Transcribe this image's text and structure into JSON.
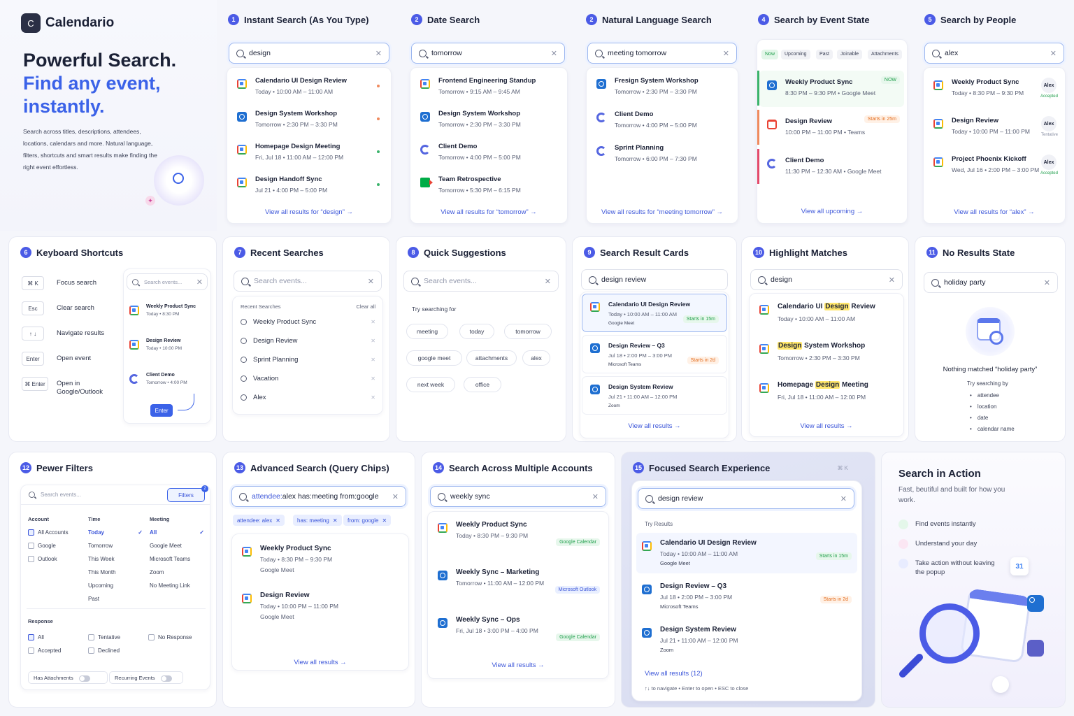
{
  "brand": {
    "logo_letter": "C",
    "name": "Calendario"
  },
  "hero": {
    "line1": "Powerful Search.",
    "line2": "Find any event,",
    "line3": "instantly.",
    "desc": "Search across titles, descriptions, attendees, locations, calendars and more. Natural language, filters, shortcuts and smart results make finding the right event effortless."
  },
  "p1": {
    "num": "1",
    "title": "Instant Search (As You Type)",
    "query": "design",
    "results": [
      {
        "t": "Calendario UI Design Review",
        "s": "Today  •  10:00 AM – 11:00 AM",
        "icon": "gcal",
        "dot": "#f08a5d"
      },
      {
        "t": "Design System Workshop",
        "s": "Tomorrow  •  2:30 PM – 3:30 PM",
        "icon": "outl",
        "dot": "#f08a5d"
      },
      {
        "t": "Homepage Design Meeting",
        "s": "Fri, Jul 18  •  11:00 AM – 12:00 PM",
        "icon": "gcal",
        "dot": "#3bb36b"
      },
      {
        "t": "Design Handoff Sync",
        "s": "Jul 21  •  4:00 PM – 5:00 PM",
        "icon": "gcal",
        "dot": "#3bb36b"
      }
    ],
    "link": "View all results for “design”  →"
  },
  "p2": {
    "num": "2",
    "title": "Date Search",
    "query": "tomorrow",
    "results": [
      {
        "t": "Frontend Engineering Standup",
        "s": "Tomorrow  •  9:15 AM – 9:45 AM",
        "icon": "gcal"
      },
      {
        "t": "Design System Workshop",
        "s": "Tomorrow  •  2:30 PM – 3:30 PM",
        "icon": "outl"
      },
      {
        "t": "Client Demo",
        "s": "Tomorrow  •  4:00 PM – 5:00 PM",
        "icon": "ccal"
      },
      {
        "t": "Team Retrospective",
        "s": "Tomorrow  •  5:30 PM – 6:15 PM",
        "icon": "gmeet"
      }
    ],
    "link": "View all results for “tomorrow”  →"
  },
  "p3": {
    "num": "2",
    "title": "Natural Language Search",
    "query": "meeting tomorrow",
    "results": [
      {
        "t": "Fresign System Workshop",
        "s": "Tomorrow  •  2:30 PM – 3:30 PM",
        "icon": "outl"
      },
      {
        "t": "Client Demo",
        "s": "Tomorrow  •  4:00 PM – 5:00 PM",
        "icon": "ccal"
      },
      {
        "t": "Sprint Planning",
        "s": "Tomorrow  •  6:00 PM – 7:30 PM",
        "icon": "ccal"
      }
    ],
    "link": "View all results for “meeting tomorrow”  →"
  },
  "p4": {
    "num": "4",
    "title": "Search by Event State",
    "tabs": [
      "Now",
      "Upcoming",
      "Past",
      "Joinable",
      "Attachments"
    ],
    "results": [
      {
        "t": "Weekly Product Sync",
        "s": "8:30 PM – 9:30 PM  •  Google Meet",
        "badge": "NOW",
        "icon": "outl"
      },
      {
        "t": "Design Review",
        "s": "10:00 PM – 11:00 PM  •  Teams",
        "badge": "Starts in 25m",
        "icon": "gmail"
      },
      {
        "t": "Client Demo",
        "s": "11:30 PM – 12:30 AM  •  Google Meet",
        "icon": "ccal"
      }
    ],
    "link": "View all upcoming  →"
  },
  "p5": {
    "num": "5",
    "title": "Search by People",
    "query": "alex",
    "results": [
      {
        "t": "Weekly Product Sync",
        "s": "Today  •  8:30 PM – 9:30 PM",
        "who": "Alex",
        "status": "Accepted"
      },
      {
        "t": "Design Review",
        "s": "Today  •  10:00 PM – 11:00 PM",
        "who": "Alex",
        "status": "Tentative"
      },
      {
        "t": "Project Phoenix Kickoff",
        "s": "Wed, Jul 16  •  2:00 PM – 3:00 PM",
        "who": "Alex",
        "status": "Accepted"
      }
    ],
    "link": "View all results for “alex”  →"
  },
  "p6": {
    "num": "6",
    "title": "Keyboard Shortcuts",
    "keys": [
      {
        "k": "⌘  K",
        "l": "Focus search"
      },
      {
        "k": "Esc",
        "l": "Clear search"
      },
      {
        "k": "↑  ↓",
        "l": "Navigate results"
      },
      {
        "k": "Enter",
        "l": "Open event"
      },
      {
        "k": "⌘ Enter",
        "l": "Open in Google/Outlook"
      }
    ],
    "placeholder": "Search events...",
    "mini": [
      {
        "t": "Weekly Product Sync",
        "s": "Today  •  8:30 PM"
      },
      {
        "t": "Design Review",
        "s": "Today  •  10:00 PM"
      },
      {
        "t": "Client Demo",
        "s": "Tomorrow  •  4:00 PM"
      }
    ],
    "enter": "Enter"
  },
  "p7": {
    "num": "7",
    "title": "Recent Searches",
    "placeholder": "Search events...",
    "head": "Recent Searches",
    "clear": "Clear all",
    "items": [
      "Weekly Product Sync",
      "Design Review",
      "Sprint Planning",
      "Vacation",
      "Alex"
    ]
  },
  "p8": {
    "num": "8",
    "title": "Quick Suggestions",
    "placeholder": "Search events...",
    "label": "Try searching for",
    "chips": [
      "meeting",
      "today",
      "tomorrow",
      "google meet",
      "attachments",
      "alex",
      "next week",
      "office"
    ]
  },
  "p9": {
    "num": "9",
    "title": "Search Result Cards",
    "query": "design review",
    "results": [
      {
        "t": "Calendario UI Design Review",
        "s": "Today  •  10:00 AM – 11:00 AM",
        "m": "Google Meet",
        "b": "Starts in 15m"
      },
      {
        "t": "Design Review – Q3",
        "s": "Jul 18  •  2:00 PM – 3:00 PM",
        "m": "Microsoft Teams",
        "b": "Starts in 2d"
      },
      {
        "t": "Design System Review",
        "s": "Jul 21  •  11:00 AM – 12:00 PM",
        "m": "Zoom"
      }
    ],
    "link": "View all results  →"
  },
  "p10": {
    "num": "10",
    "title": "Highlight Matches",
    "query": "design",
    "results": [
      {
        "pre": "Calendario UI ",
        "hl": "Design",
        "post": " Review",
        "s": "Today  •  10:00 AM – 11:00 AM"
      },
      {
        "pre": "",
        "hl": "Design",
        "post": " System Workshop",
        "s": "Tomorrow  •  2:30 PM – 3:30 PM"
      },
      {
        "pre": "Homepage ",
        "hl": "Design",
        "post": " Meeting",
        "s": "Fri, Jul 18  •  11:00 AM – 12:00 PM"
      }
    ],
    "link": "View all results  →"
  },
  "p11": {
    "num": "11",
    "title": "No Results State",
    "query": "holiday party",
    "msg": "Nothing matched “holiday party”",
    "sub": "Try searching by",
    "tips": [
      "attendee",
      "location",
      "date",
      "calendar name"
    ]
  },
  "p12": {
    "num": "12",
    "title": "Pewer Filters",
    "placeholder": "Search events...",
    "filters": "Filters",
    "badge": "2",
    "account_h": "Account",
    "accounts": [
      "All Accounts",
      "Google",
      "Outlook"
    ],
    "time_h": "Time",
    "times": [
      "Today",
      "Tomorrow",
      "This Week",
      "This Month",
      "Upcoming",
      "Past"
    ],
    "meet_h": "Meeting",
    "meets": [
      "All",
      "Google Meet",
      "Microsoft Teams",
      "Zoom",
      "No Meeting Link"
    ],
    "resp_h": "Response",
    "resp": [
      "All",
      "Tentative",
      "No Response",
      "Accepted",
      "Declined"
    ],
    "t1": "Has Attachments",
    "t2": "Recurring Events"
  },
  "p13": {
    "num": "13",
    "title": "Advanced Search (Query Chips)",
    "q_key": "attendee:",
    "q_val": "alex has:meeting from:google",
    "chips": [
      "attendee: alex",
      "has: meeting",
      "from: google"
    ],
    "results": [
      {
        "t": "Weekly Product Sync",
        "s": "Today  •  8:30 PM – 9:30 PM",
        "m": "Google Meet"
      },
      {
        "t": "Design Review",
        "s": "Today  •  10:00 PM – 11:00 PM",
        "m": "Google Meet"
      }
    ],
    "link": "View all results  →"
  },
  "p14": {
    "num": "14",
    "title": "Search Across Multiple Accounts",
    "query": "weekly sync",
    "results": [
      {
        "t": "Weekly Product Sync",
        "s": "Today  •  8:30 PM – 9:30 PM",
        "b": "Google Calendar"
      },
      {
        "t": "Weekly Sync – Marketing",
        "s": "Tomorrow  •  11:00 AM – 12:00 PM",
        "b": "Microsoft Outlook"
      },
      {
        "t": "Weekly Sync – Ops",
        "s": "Fri, Jul 18  •  3:00 PM – 4:00 PM",
        "b": "Google Calendar"
      }
    ],
    "link": "View all results  →"
  },
  "p15": {
    "num": "15",
    "title": "Focused Search Experience",
    "kbd": "⌘ K",
    "query": "design review",
    "label": "Try Results",
    "results": [
      {
        "t": "Calendario UI Design Review",
        "s": "Today  •  10:00 AM – 11:00 AM",
        "m": "Google Meet",
        "b": "Starts in 15m"
      },
      {
        "t": "Design Review – Q3",
        "s": "Jul 18  •  2:00 PM – 3:00 PM",
        "m": "Microsoft Teams",
        "b": "Starts in 2d"
      },
      {
        "t": "Design System Review",
        "s": "Jul 21  •  11:00 AM – 12:00 PM",
        "m": "Zoom"
      }
    ],
    "link": "View all results (12)",
    "hint": "↑↓  to navigate  •  Enter  to open  •  ESC  to close"
  },
  "action": {
    "title": "Search in Action",
    "sub": "Fast, beutiful and built for how you work.",
    "feats": [
      "Find events instantly",
      "Understand your day",
      "Take action without leaving the popup"
    ],
    "cal_day": "31"
  }
}
